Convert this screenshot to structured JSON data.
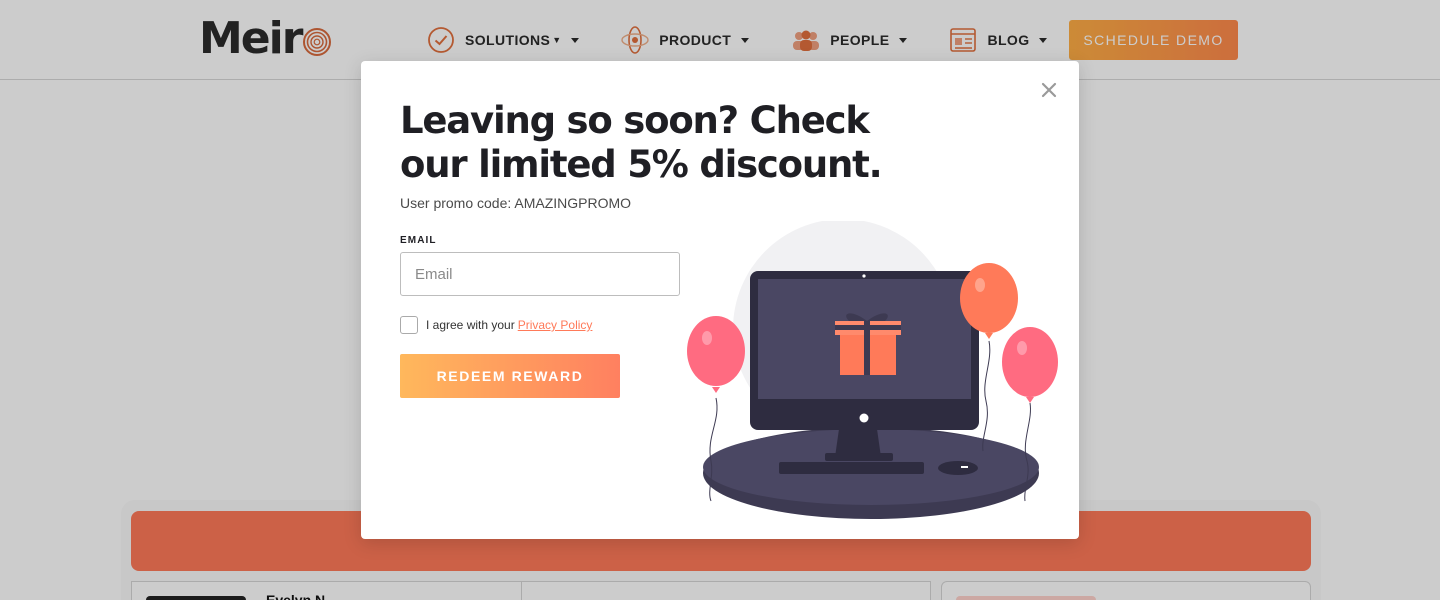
{
  "header": {
    "logo_text": "Meir",
    "nav": [
      {
        "label": "SOLUTIONS",
        "icon": "check-circle-icon"
      },
      {
        "label": "PRODUCT",
        "icon": "atom-icon"
      },
      {
        "label": "PEOPLE",
        "icon": "people-icon"
      },
      {
        "label": "BLOG",
        "icon": "blog-icon"
      }
    ],
    "cta_label": "SCHEDULE DEMO"
  },
  "background": {
    "card_title": "Evelyn N"
  },
  "modal": {
    "title": "Leaving so soon? Check our limited 5% discount.",
    "promo_text": "User promo code: AMAZINGPROMO",
    "email_label": "EMAIL",
    "email_placeholder": "Email",
    "email_value": "",
    "agree_text": "I agree with your",
    "privacy_link": "Privacy Policy",
    "agree_checked": false,
    "submit_label": "REDEEM REWARD",
    "close_icon": "close-icon",
    "illustration": "gift-on-monitor-with-balloons"
  },
  "colors": {
    "accent": "#ff7a59",
    "button_gradient_start": "#ffb85c",
    "button_gradient_end": "#ff8060",
    "heading": "#1f1f24"
  }
}
